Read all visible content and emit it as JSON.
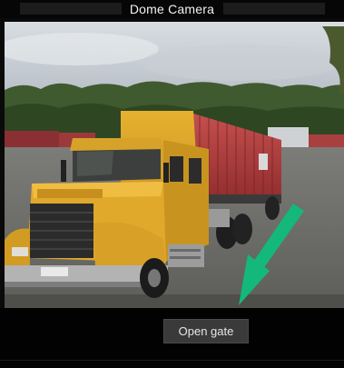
{
  "window": {
    "title": "Dome Camera"
  },
  "feed": {
    "description_icon": "camera-feed",
    "arrow_color": "#14b87a"
  },
  "actions": {
    "open_gate_label": "Open gate"
  }
}
